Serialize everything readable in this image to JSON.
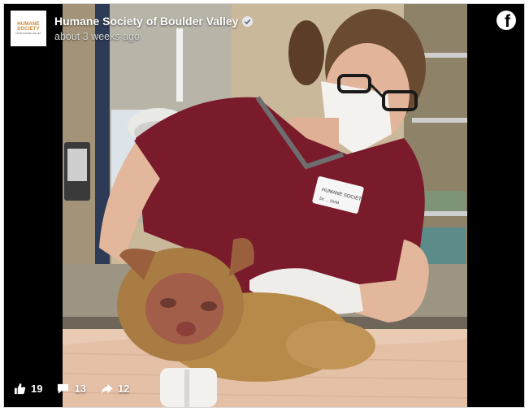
{
  "post": {
    "page_name": "Humane Society of Boulder Valley",
    "timestamp": "about 3 weeks ago",
    "logo": {
      "line1": "HUMANE",
      "line2": "SOCIETY",
      "line3": "OF BOULDER VALLEY"
    },
    "verified_icon": "check-badge-icon",
    "platform_icon": "facebook-icon"
  },
  "photo": {
    "badge_line1": "HUMANE SOCIETY",
    "badge_line2": "Dr. ... DVM"
  },
  "stats": {
    "likes": "19",
    "comments": "13",
    "shares": "12"
  },
  "colors": {
    "frame": "#000000",
    "logo_accent": "#c8852b",
    "scrubs": "#7a1b2c"
  }
}
